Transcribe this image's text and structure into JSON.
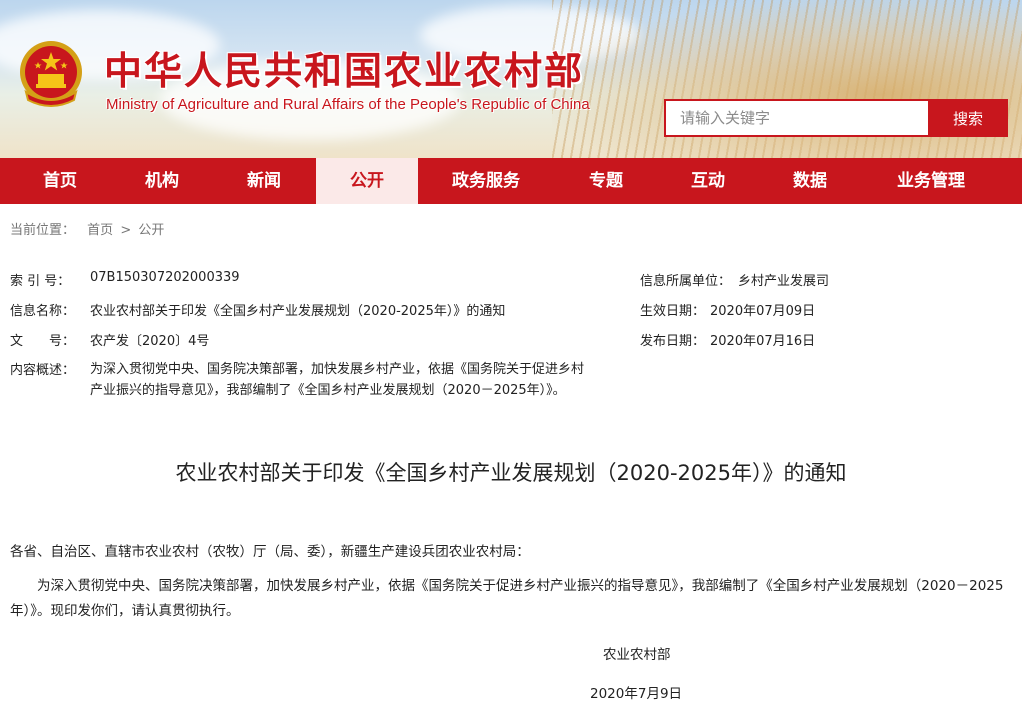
{
  "header": {
    "title_cn": "中华人民共和国农业农村部",
    "title_en": "Ministry of Agriculture and Rural Affairs of the People's Republic of China",
    "search_placeholder": "请输入关键字",
    "search_button": "搜索",
    "colors": {
      "brand_red": "#c8161d",
      "gold": "#f5c518"
    }
  },
  "nav": {
    "items": [
      {
        "label": "首页",
        "active": false
      },
      {
        "label": "机构",
        "active": false
      },
      {
        "label": "新闻",
        "active": false
      },
      {
        "label": "公开",
        "active": true
      },
      {
        "label": "政务服务",
        "active": false
      },
      {
        "label": "专题",
        "active": false
      },
      {
        "label": "互动",
        "active": false
      },
      {
        "label": "数据",
        "active": false
      },
      {
        "label": "业务管理",
        "active": false
      }
    ]
  },
  "breadcrumb": {
    "prefix": "当前位置：",
    "home": "首页",
    "separator": ">",
    "current": "公开"
  },
  "info": {
    "index_label": "索 引 号：",
    "index_value": "07B150307202000339",
    "name_label": "信息名称：",
    "name_value": "农业农村部关于印发《全国乡村产业发展规划（2020-2025年）》的通知",
    "docno_label": "文　　号：",
    "docno_value": "农产发〔2020〕4号",
    "summary_label": "内容概述：",
    "summary_value": "为深入贯彻党中央、国务院决策部署，加快发展乡村产业，依据《国务院关于促进乡村产业振兴的指导意见》，我部编制了《全国乡村产业发展规划（2020－2025年）》。",
    "unit_label": "信息所属单位：",
    "unit_value": "乡村产业发展司",
    "effective_label": "生效日期：",
    "effective_value": "2020年07月09日",
    "publish_label": "发布日期：",
    "publish_value": "2020年07月16日"
  },
  "document": {
    "title": "农业农村部关于印发《全国乡村产业发展规划（2020-2025年）》的通知",
    "addressee": "各省、自治区、直辖市农业农村（农牧）厅（局、委），新疆生产建设兵团农业农村局：",
    "body": "为深入贯彻党中央、国务院决策部署，加快发展乡村产业，依据《国务院关于促进乡村产业振兴的指导意见》，我部编制了《全国乡村产业发展规划（2020－2025年）》。现印发你们，请认真贯彻执行。",
    "signature": "农业农村部",
    "date": "2020年7月9日"
  }
}
